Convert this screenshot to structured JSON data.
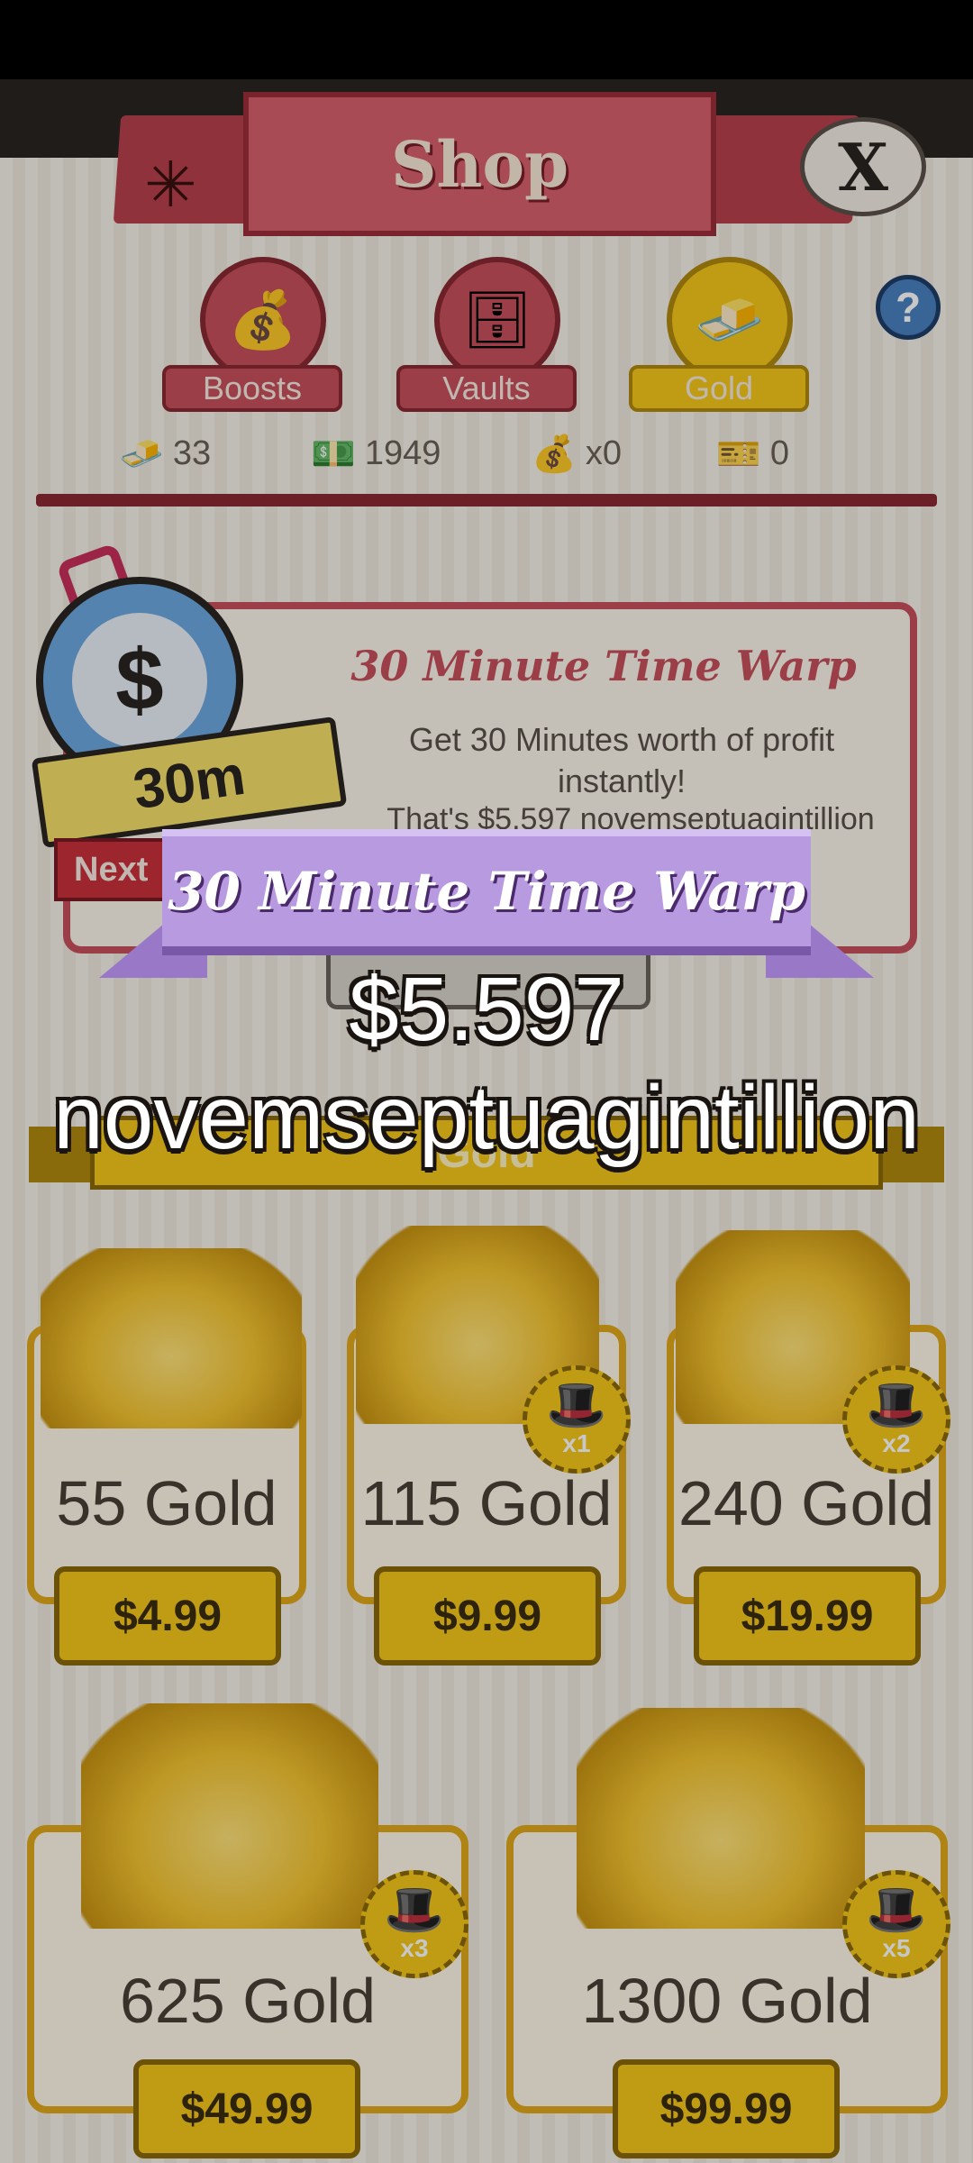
{
  "shop": {
    "title": "Shop",
    "close_label": "X",
    "help_label": "?",
    "tabs": [
      {
        "label": "Boosts",
        "icon": "boost-bag-icon",
        "active": false
      },
      {
        "label": "Vaults",
        "icon": "vault-icon",
        "active": false
      },
      {
        "label": "Gold",
        "icon": "gold-bar-icon",
        "active": true
      }
    ],
    "currencies": [
      {
        "icon": "gold-icon",
        "value": "33"
      },
      {
        "icon": "megabucks-icon",
        "value": "1949"
      },
      {
        "icon": "money-bag-icon",
        "value": "x0"
      },
      {
        "icon": "megaticket-icon",
        "value": "0"
      }
    ]
  },
  "time_warp_card": {
    "title": "30 Minute Time Warp",
    "description": "Get 30 Minutes worth of profit instantly!",
    "profit_line": "That's $5.597 novemseptuagintillion",
    "badge_label": "30m",
    "next_label": "Next"
  },
  "gold_section": {
    "title": "Gold",
    "packs": [
      {
        "amount": "55 Gold",
        "price": "$4.99",
        "multiplier": ""
      },
      {
        "amount": "115 Gold",
        "price": "$9.99",
        "multiplier": "x1"
      },
      {
        "amount": "240 Gold",
        "price": "$19.99",
        "multiplier": "x2"
      },
      {
        "amount": "625 Gold",
        "price": "$49.99",
        "multiplier": "x3"
      },
      {
        "amount": "1300 Gold",
        "price": "$99.99",
        "multiplier": "x5"
      }
    ]
  },
  "popup": {
    "title": "30 Minute Time Warp",
    "amount_line1": "$5.597",
    "amount_line2": "novemseptuagintillion"
  },
  "colors": {
    "header_red": "#d8606e",
    "gold_accent": "#f6c81a",
    "ribbon_purple": "#b89ae0"
  }
}
